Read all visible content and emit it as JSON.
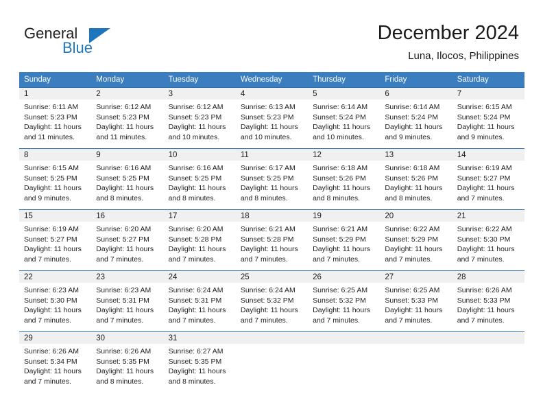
{
  "brand": {
    "name_top": "General",
    "name_bottom": "Blue",
    "color_dark": "#231f20",
    "color_blue": "#1f76bc"
  },
  "header": {
    "title": "December 2024",
    "subtitle": "Luna, Ilocos, Philippines"
  },
  "theme": {
    "header_bg": "#3a7ebf",
    "row_rule": "#2f6da8",
    "daynum_bg": "#f0f0f0"
  },
  "weekday_headers": [
    "Sunday",
    "Monday",
    "Tuesday",
    "Wednesday",
    "Thursday",
    "Friday",
    "Saturday"
  ],
  "weeks": [
    [
      {
        "day": "1",
        "sunrise": "Sunrise: 6:11 AM",
        "sunset": "Sunset: 5:23 PM",
        "daylight_1": "Daylight: 11 hours",
        "daylight_2": "and 11 minutes."
      },
      {
        "day": "2",
        "sunrise": "Sunrise: 6:12 AM",
        "sunset": "Sunset: 5:23 PM",
        "daylight_1": "Daylight: 11 hours",
        "daylight_2": "and 11 minutes."
      },
      {
        "day": "3",
        "sunrise": "Sunrise: 6:12 AM",
        "sunset": "Sunset: 5:23 PM",
        "daylight_1": "Daylight: 11 hours",
        "daylight_2": "and 10 minutes."
      },
      {
        "day": "4",
        "sunrise": "Sunrise: 6:13 AM",
        "sunset": "Sunset: 5:23 PM",
        "daylight_1": "Daylight: 11 hours",
        "daylight_2": "and 10 minutes."
      },
      {
        "day": "5",
        "sunrise": "Sunrise: 6:14 AM",
        "sunset": "Sunset: 5:24 PM",
        "daylight_1": "Daylight: 11 hours",
        "daylight_2": "and 10 minutes."
      },
      {
        "day": "6",
        "sunrise": "Sunrise: 6:14 AM",
        "sunset": "Sunset: 5:24 PM",
        "daylight_1": "Daylight: 11 hours",
        "daylight_2": "and 9 minutes."
      },
      {
        "day": "7",
        "sunrise": "Sunrise: 6:15 AM",
        "sunset": "Sunset: 5:24 PM",
        "daylight_1": "Daylight: 11 hours",
        "daylight_2": "and 9 minutes."
      }
    ],
    [
      {
        "day": "8",
        "sunrise": "Sunrise: 6:15 AM",
        "sunset": "Sunset: 5:25 PM",
        "daylight_1": "Daylight: 11 hours",
        "daylight_2": "and 9 minutes."
      },
      {
        "day": "9",
        "sunrise": "Sunrise: 6:16 AM",
        "sunset": "Sunset: 5:25 PM",
        "daylight_1": "Daylight: 11 hours",
        "daylight_2": "and 8 minutes."
      },
      {
        "day": "10",
        "sunrise": "Sunrise: 6:16 AM",
        "sunset": "Sunset: 5:25 PM",
        "daylight_1": "Daylight: 11 hours",
        "daylight_2": "and 8 minutes."
      },
      {
        "day": "11",
        "sunrise": "Sunrise: 6:17 AM",
        "sunset": "Sunset: 5:25 PM",
        "daylight_1": "Daylight: 11 hours",
        "daylight_2": "and 8 minutes."
      },
      {
        "day": "12",
        "sunrise": "Sunrise: 6:18 AM",
        "sunset": "Sunset: 5:26 PM",
        "daylight_1": "Daylight: 11 hours",
        "daylight_2": "and 8 minutes."
      },
      {
        "day": "13",
        "sunrise": "Sunrise: 6:18 AM",
        "sunset": "Sunset: 5:26 PM",
        "daylight_1": "Daylight: 11 hours",
        "daylight_2": "and 8 minutes."
      },
      {
        "day": "14",
        "sunrise": "Sunrise: 6:19 AM",
        "sunset": "Sunset: 5:27 PM",
        "daylight_1": "Daylight: 11 hours",
        "daylight_2": "and 7 minutes."
      }
    ],
    [
      {
        "day": "15",
        "sunrise": "Sunrise: 6:19 AM",
        "sunset": "Sunset: 5:27 PM",
        "daylight_1": "Daylight: 11 hours",
        "daylight_2": "and 7 minutes."
      },
      {
        "day": "16",
        "sunrise": "Sunrise: 6:20 AM",
        "sunset": "Sunset: 5:27 PM",
        "daylight_1": "Daylight: 11 hours",
        "daylight_2": "and 7 minutes."
      },
      {
        "day": "17",
        "sunrise": "Sunrise: 6:20 AM",
        "sunset": "Sunset: 5:28 PM",
        "daylight_1": "Daylight: 11 hours",
        "daylight_2": "and 7 minutes."
      },
      {
        "day": "18",
        "sunrise": "Sunrise: 6:21 AM",
        "sunset": "Sunset: 5:28 PM",
        "daylight_1": "Daylight: 11 hours",
        "daylight_2": "and 7 minutes."
      },
      {
        "day": "19",
        "sunrise": "Sunrise: 6:21 AM",
        "sunset": "Sunset: 5:29 PM",
        "daylight_1": "Daylight: 11 hours",
        "daylight_2": "and 7 minutes."
      },
      {
        "day": "20",
        "sunrise": "Sunrise: 6:22 AM",
        "sunset": "Sunset: 5:29 PM",
        "daylight_1": "Daylight: 11 hours",
        "daylight_2": "and 7 minutes."
      },
      {
        "day": "21",
        "sunrise": "Sunrise: 6:22 AM",
        "sunset": "Sunset: 5:30 PM",
        "daylight_1": "Daylight: 11 hours",
        "daylight_2": "and 7 minutes."
      }
    ],
    [
      {
        "day": "22",
        "sunrise": "Sunrise: 6:23 AM",
        "sunset": "Sunset: 5:30 PM",
        "daylight_1": "Daylight: 11 hours",
        "daylight_2": "and 7 minutes."
      },
      {
        "day": "23",
        "sunrise": "Sunrise: 6:23 AM",
        "sunset": "Sunset: 5:31 PM",
        "daylight_1": "Daylight: 11 hours",
        "daylight_2": "and 7 minutes."
      },
      {
        "day": "24",
        "sunrise": "Sunrise: 6:24 AM",
        "sunset": "Sunset: 5:31 PM",
        "daylight_1": "Daylight: 11 hours",
        "daylight_2": "and 7 minutes."
      },
      {
        "day": "25",
        "sunrise": "Sunrise: 6:24 AM",
        "sunset": "Sunset: 5:32 PM",
        "daylight_1": "Daylight: 11 hours",
        "daylight_2": "and 7 minutes."
      },
      {
        "day": "26",
        "sunrise": "Sunrise: 6:25 AM",
        "sunset": "Sunset: 5:32 PM",
        "daylight_1": "Daylight: 11 hours",
        "daylight_2": "and 7 minutes."
      },
      {
        "day": "27",
        "sunrise": "Sunrise: 6:25 AM",
        "sunset": "Sunset: 5:33 PM",
        "daylight_1": "Daylight: 11 hours",
        "daylight_2": "and 7 minutes."
      },
      {
        "day": "28",
        "sunrise": "Sunrise: 6:26 AM",
        "sunset": "Sunset: 5:33 PM",
        "daylight_1": "Daylight: 11 hours",
        "daylight_2": "and 7 minutes."
      }
    ],
    [
      {
        "day": "29",
        "sunrise": "Sunrise: 6:26 AM",
        "sunset": "Sunset: 5:34 PM",
        "daylight_1": "Daylight: 11 hours",
        "daylight_2": "and 7 minutes."
      },
      {
        "day": "30",
        "sunrise": "Sunrise: 6:26 AM",
        "sunset": "Sunset: 5:35 PM",
        "daylight_1": "Daylight: 11 hours",
        "daylight_2": "and 8 minutes."
      },
      {
        "day": "31",
        "sunrise": "Sunrise: 6:27 AM",
        "sunset": "Sunset: 5:35 PM",
        "daylight_1": "Daylight: 11 hours",
        "daylight_2": "and 8 minutes."
      },
      {
        "day": "",
        "sunrise": "",
        "sunset": "",
        "daylight_1": "",
        "daylight_2": ""
      },
      {
        "day": "",
        "sunrise": "",
        "sunset": "",
        "daylight_1": "",
        "daylight_2": ""
      },
      {
        "day": "",
        "sunrise": "",
        "sunset": "",
        "daylight_1": "",
        "daylight_2": ""
      },
      {
        "day": "",
        "sunrise": "",
        "sunset": "",
        "daylight_1": "",
        "daylight_2": ""
      }
    ]
  ]
}
